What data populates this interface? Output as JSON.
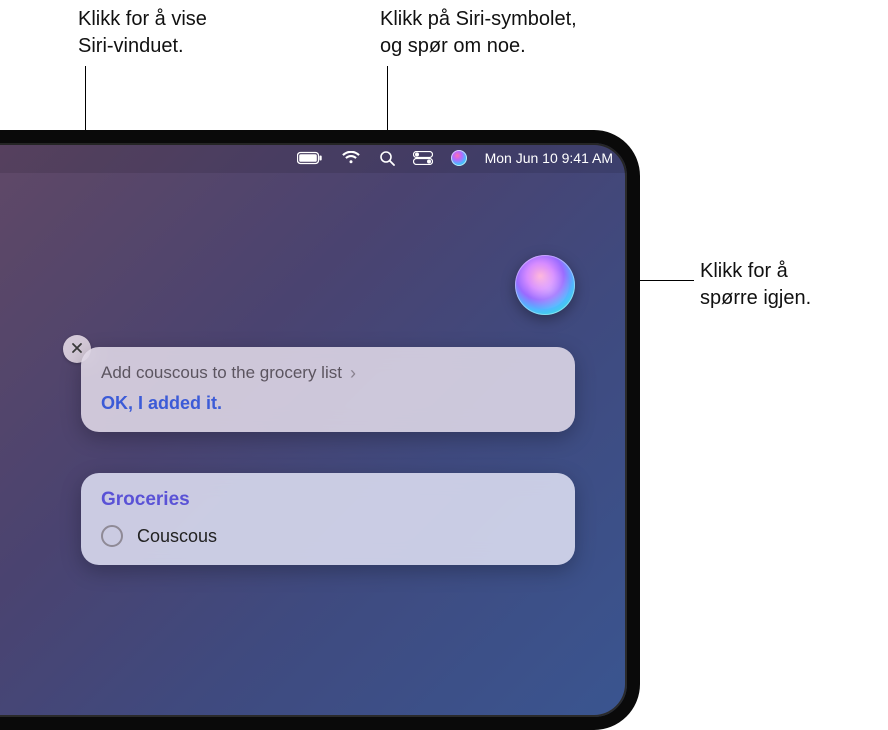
{
  "callouts": {
    "show_window_l1": "Klikk for å vise",
    "show_window_l2": "Siri-vinduet.",
    "click_icon_l1": "Klikk på Siri-symbolet,",
    "click_icon_l2": "og spør om noe.",
    "ask_again_l1": "Klikk for å",
    "ask_again_l2": "spørre igjen."
  },
  "menubar": {
    "date_time": "Mon Jun 10  9:41 AM"
  },
  "siri": {
    "request": "Add couscous to the grocery list",
    "response": "OK, I added it.",
    "list_title": "Groceries",
    "list_items": [
      "Couscous"
    ]
  },
  "colors": {
    "link_blue": "#3c5bd7",
    "title_purple": "#5a52d6"
  }
}
